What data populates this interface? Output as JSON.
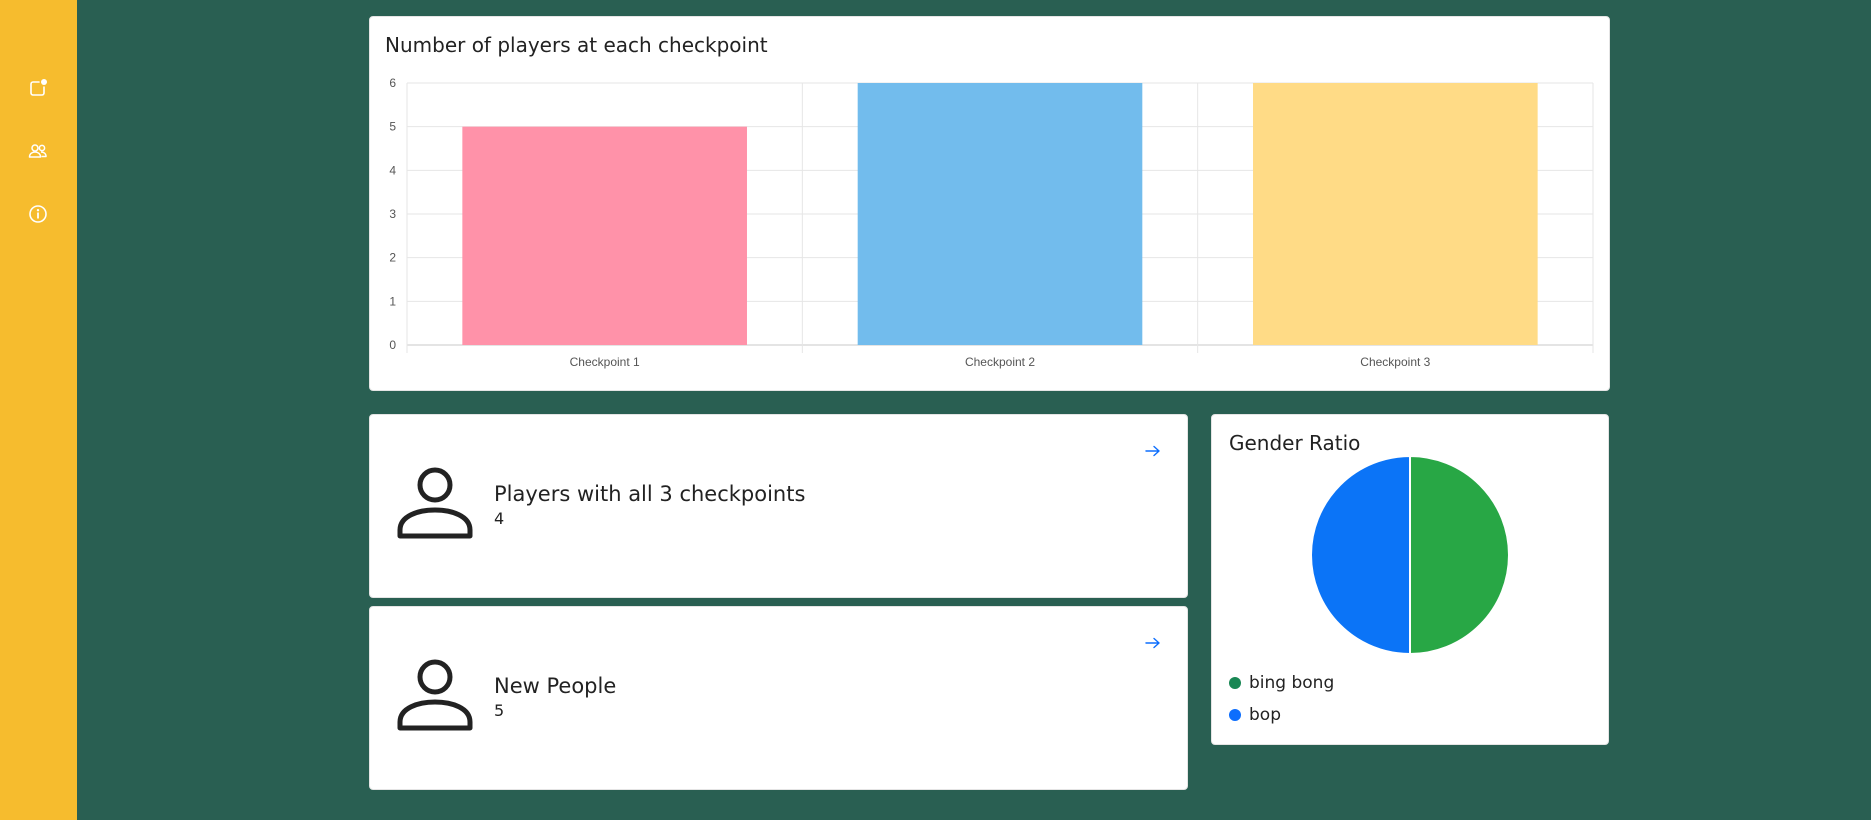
{
  "sidebar": {
    "items": [
      {
        "icon": "notification-icon"
      },
      {
        "icon": "people-icon"
      },
      {
        "icon": "info-icon"
      }
    ]
  },
  "checkpoint_card": {
    "title": "Number of players at each checkpoint"
  },
  "chart_data": [
    {
      "type": "bar",
      "title": "Number of players at each checkpoint",
      "categories": [
        "Checkpoint 1",
        "Checkpoint 2",
        "Checkpoint 3"
      ],
      "values": [
        5,
        6,
        6
      ],
      "colors": [
        "#ff92a9",
        "#72bced",
        "#ffdb86"
      ],
      "yticks": [
        "0",
        "1",
        "2",
        "3",
        "4",
        "5",
        "6"
      ],
      "ylim": [
        0,
        6
      ],
      "grid": true,
      "xlabel": "",
      "ylabel": ""
    },
    {
      "type": "pie",
      "title": "Gender Ratio",
      "labels": [
        "bing bong",
        "bop"
      ],
      "values": [
        50,
        50
      ],
      "colors": [
        "#28a745",
        "#0b74f7"
      ],
      "legend_colors": [
        "#198754",
        "#0d6efd"
      ],
      "legend": "bottom-left"
    }
  ],
  "stats": [
    {
      "title": "Players with all 3 checkpoints",
      "value": "4"
    },
    {
      "title": "New People",
      "value": "5"
    }
  ],
  "gender_card": {
    "title": "Gender Ratio",
    "legend": [
      {
        "label": "bing bong"
      },
      {
        "label": "bop"
      }
    ]
  }
}
